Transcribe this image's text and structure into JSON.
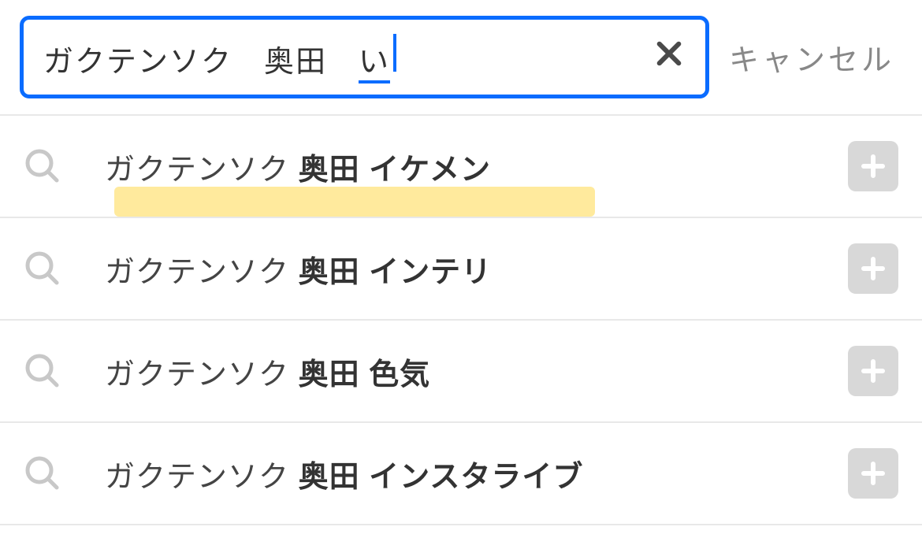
{
  "search": {
    "query_prefix": "ガクテンソク　奥田　",
    "ime_text": "い",
    "cancel_label": "キャンセル"
  },
  "suggestions": [
    {
      "prefix": "ガクテンソク ",
      "bold": "奥田 イケメン",
      "highlighted": true
    },
    {
      "prefix": "ガクテンソク ",
      "bold": "奥田 インテリ",
      "highlighted": false
    },
    {
      "prefix": "ガクテンソク ",
      "bold": "奥田 色気",
      "highlighted": false
    },
    {
      "prefix": "ガクテンソク ",
      "bold": "奥田 インスタライブ",
      "highlighted": false
    }
  ]
}
